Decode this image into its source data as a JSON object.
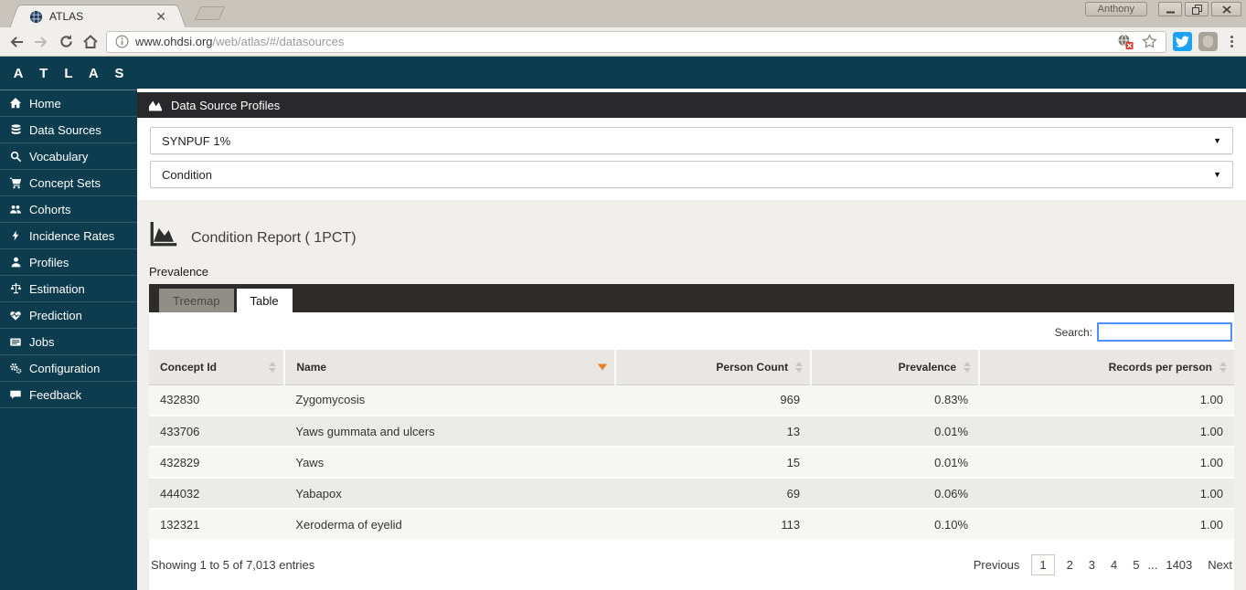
{
  "colors": {
    "teal": "#0d3c4e",
    "accent_orange": "#e87e1e",
    "focus_blue": "#4d90fe",
    "twitter_blue": "#1da1f2",
    "header_dark": "#29292b"
  },
  "browser": {
    "tab_title": "ATLAS",
    "profile_name": "Anthony",
    "url_host": "www.ohdsi.org",
    "url_path": "/web/atlas/#/datasources"
  },
  "sidebar": {
    "logo": "A T L A S",
    "items": [
      {
        "label": "Home",
        "icon": "home-icon"
      },
      {
        "label": "Data Sources",
        "icon": "database-icon"
      },
      {
        "label": "Vocabulary",
        "icon": "search-icon"
      },
      {
        "label": "Concept Sets",
        "icon": "cart-icon"
      },
      {
        "label": "Cohorts",
        "icon": "users-icon"
      },
      {
        "label": "Incidence Rates",
        "icon": "bolt-icon"
      },
      {
        "label": "Profiles",
        "icon": "user-icon"
      },
      {
        "label": "Estimation",
        "icon": "scales-icon"
      },
      {
        "label": "Prediction",
        "icon": "heartbeat-icon"
      },
      {
        "label": "Jobs",
        "icon": "list-icon"
      },
      {
        "label": "Configuration",
        "icon": "gears-icon"
      },
      {
        "label": "Feedback",
        "icon": "comment-icon"
      }
    ]
  },
  "header": {
    "title": "Data Source Profiles"
  },
  "filters": {
    "source": "SYNPUF 1%",
    "domain": "Condition"
  },
  "report": {
    "title": "Condition Report ( 1PCT)",
    "section_label": "Prevalence",
    "tabs": [
      {
        "label": "Treemap",
        "active": false
      },
      {
        "label": "Table",
        "active": true
      }
    ],
    "search_label": "Search:",
    "search_value": ""
  },
  "table": {
    "columns": [
      {
        "label": "Concept Id",
        "align": "left",
        "sort": "both",
        "width": "12.5%"
      },
      {
        "label": "Name",
        "align": "left",
        "sort": "desc",
        "width": "30.5%"
      },
      {
        "label": "Person Count",
        "align": "right",
        "sort": "both",
        "width": "18%"
      },
      {
        "label": "Prevalence",
        "align": "right",
        "sort": "both",
        "width": "15.5%"
      },
      {
        "label": "Records per person",
        "align": "right",
        "sort": "both",
        "width": "23.5%"
      }
    ],
    "rows": [
      [
        "432830",
        "Zygomycosis",
        "969",
        "0.83%",
        "1.00"
      ],
      [
        "433706",
        "Yaws gummata and ulcers",
        "13",
        "0.01%",
        "1.00"
      ],
      [
        "432829",
        "Yaws",
        "15",
        "0.01%",
        "1.00"
      ],
      [
        "444032",
        "Yabapox",
        "69",
        "0.06%",
        "1.00"
      ],
      [
        "132321",
        "Xeroderma of eyelid",
        "113",
        "0.10%",
        "1.00"
      ]
    ],
    "footer": {
      "summary": "Showing 1 to 5 of 7,013 entries",
      "pagination": [
        {
          "label": "Previous",
          "state": "normal"
        },
        {
          "label": "1",
          "state": "current"
        },
        {
          "label": "2",
          "state": "normal"
        },
        {
          "label": "3",
          "state": "normal"
        },
        {
          "label": "4",
          "state": "normal"
        },
        {
          "label": "5",
          "state": "normal"
        },
        {
          "label": "...",
          "state": "ellipsis"
        },
        {
          "label": "1403",
          "state": "normal"
        },
        {
          "label": "Next",
          "state": "normal"
        }
      ]
    }
  }
}
